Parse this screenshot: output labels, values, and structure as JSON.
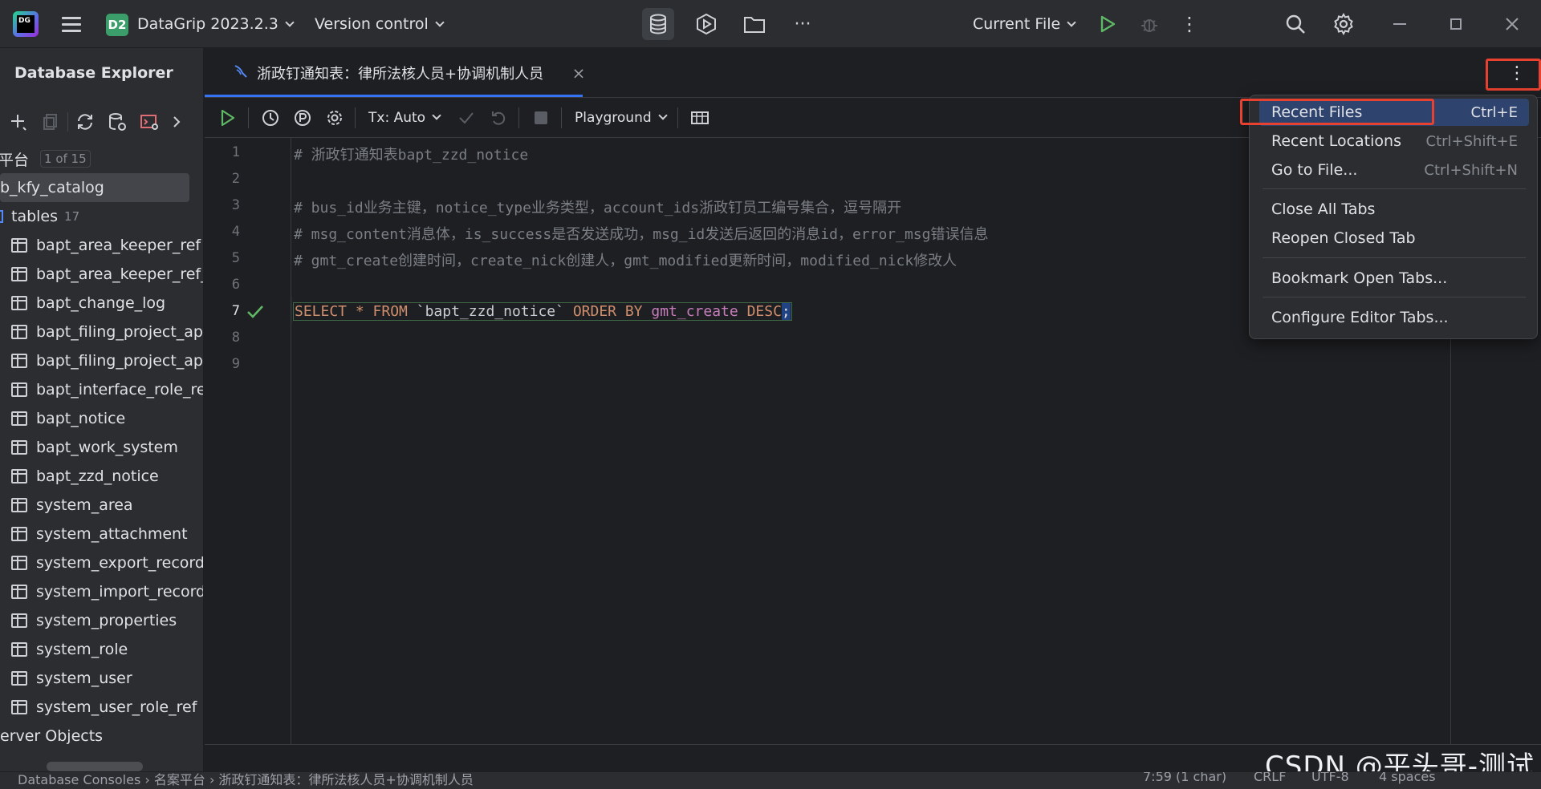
{
  "titlebar": {
    "project_badge": "D2",
    "project_name": "DataGrip 2023.2.3",
    "vcs_label": "Version control",
    "run_config": "Current File",
    "icons": [
      "app-logo",
      "main-menu-icon",
      "database-icon",
      "services-icon",
      "folder-icon",
      "more-icon",
      "run-icon",
      "debug-icon",
      "kebab-icon",
      "search-icon",
      "gear-icon",
      "minimize-icon",
      "restore-icon",
      "close-icon"
    ]
  },
  "left_panel": {
    "title": "Database Explorer",
    "schema_label": "平台",
    "pager": "1 of 15",
    "catalog": "b_kfy_catalog",
    "tables_label": "tables",
    "tables_count": "17",
    "tables": [
      "bapt_area_keeper_ref",
      "bapt_area_keeper_ref_",
      "bapt_change_log",
      "bapt_filing_project_app",
      "bapt_filing_project_app",
      "bapt_interface_role_ref",
      "bapt_notice",
      "bapt_work_system",
      "bapt_zzd_notice",
      "system_area",
      "system_attachment",
      "system_export_record",
      "system_import_record",
      "system_properties",
      "system_role",
      "system_user",
      "system_user_role_ref"
    ],
    "server_objects": "erver Objects"
  },
  "editor": {
    "tab_title": "浙政钉通知表：律所法核人员+协调机制人员",
    "tx_label": "Tx: Auto",
    "playground_label": "Playground",
    "line_numbers": [
      "1",
      "2",
      "3",
      "4",
      "5",
      "6",
      "7",
      "8",
      "9"
    ],
    "lines": {
      "l1": "# 浙政钉通知表bapt_zzd_notice",
      "l3": "# bus_id业务主键，notice_type业务类型，account_ids浙政钉员工编号集合，逗号隔开",
      "l4": "# msg_content消息体，is_success是否发送成功，msg_id发送后返回的消息id，error_msg错误信息",
      "l5": "# gmt_create创建时间，create_nick创建人，gmt_modified更新时间，modified_nick修改人",
      "l7_select": "SELECT",
      "l7_star": " * ",
      "l7_from": "FROM",
      "l7_table": " `bapt_zzd_notice` ",
      "l7_order": "ORDER BY",
      "l7_col": " gmt_create ",
      "l7_desc": "DESC",
      "l7_end": ";"
    }
  },
  "menu": {
    "items": [
      {
        "label": "Recent Files",
        "shortcut": "Ctrl+E"
      },
      {
        "label": "Recent Locations",
        "shortcut": "Ctrl+Shift+E"
      },
      {
        "label": "Go to File...",
        "shortcut": "Ctrl+Shift+N"
      },
      {
        "label": "Close All Tabs",
        "shortcut": ""
      },
      {
        "label": "Reopen Closed Tab",
        "shortcut": ""
      },
      {
        "label": "Bookmark Open Tabs...",
        "shortcut": ""
      },
      {
        "label": "Configure Editor Tabs...",
        "shortcut": ""
      }
    ]
  },
  "statusbar": {
    "breadcrumb": "Database Consoles  ›  名案平台  ›  浙政钉通知表：律所法核人员+协调机制人员",
    "position": "7:59 (1 char)",
    "line_sep": "CRLF",
    "encoding": "UTF-8",
    "indent": "4 spaces"
  },
  "watermark": "CSDN @平头哥-测试",
  "colors": {
    "highlight_box": "#e8412f",
    "menu_selected": "#2e436e",
    "accent": "#3574f0"
  }
}
